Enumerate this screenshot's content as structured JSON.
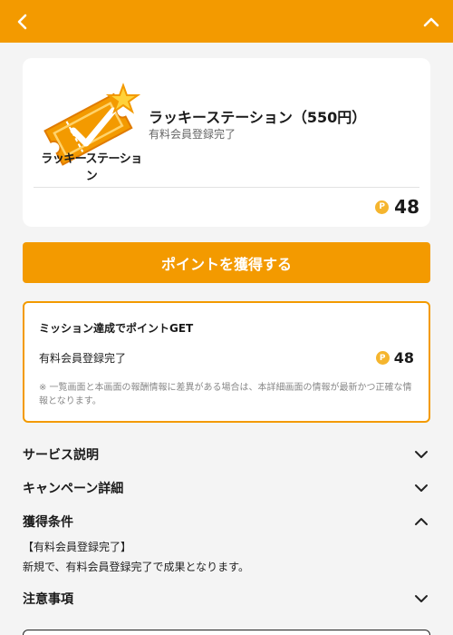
{
  "header": {
    "back_icon": "chevron-left-icon",
    "collapse_icon": "chevron-up-icon",
    "color": "#f39a00"
  },
  "offer": {
    "logo_text": "ラッキーステーション",
    "title": "ラッキーステーション（550円）",
    "subtitle": "有料会員登録完了",
    "points": "48",
    "coin_symbol": "P"
  },
  "cta": {
    "label": "ポイントを獲得する"
  },
  "mission": {
    "title": "ミッション達成でポイントGET",
    "label": "有料会員登録完了",
    "points": "48",
    "coin_symbol": "P",
    "note": "※ 一覧画面と本画面の報酬情報に差異がある場合は、本詳細画面の情報が最新かつ正確な情報となります。"
  },
  "sections": {
    "service": "サービス説明",
    "campaign": "キャンペーン詳細",
    "conditions": "獲得条件",
    "notes": "注意事項"
  },
  "conditions": {
    "heading": "【有料会員登録完了】",
    "body": "新規で、有料会員登録完了で成果となります。"
  }
}
